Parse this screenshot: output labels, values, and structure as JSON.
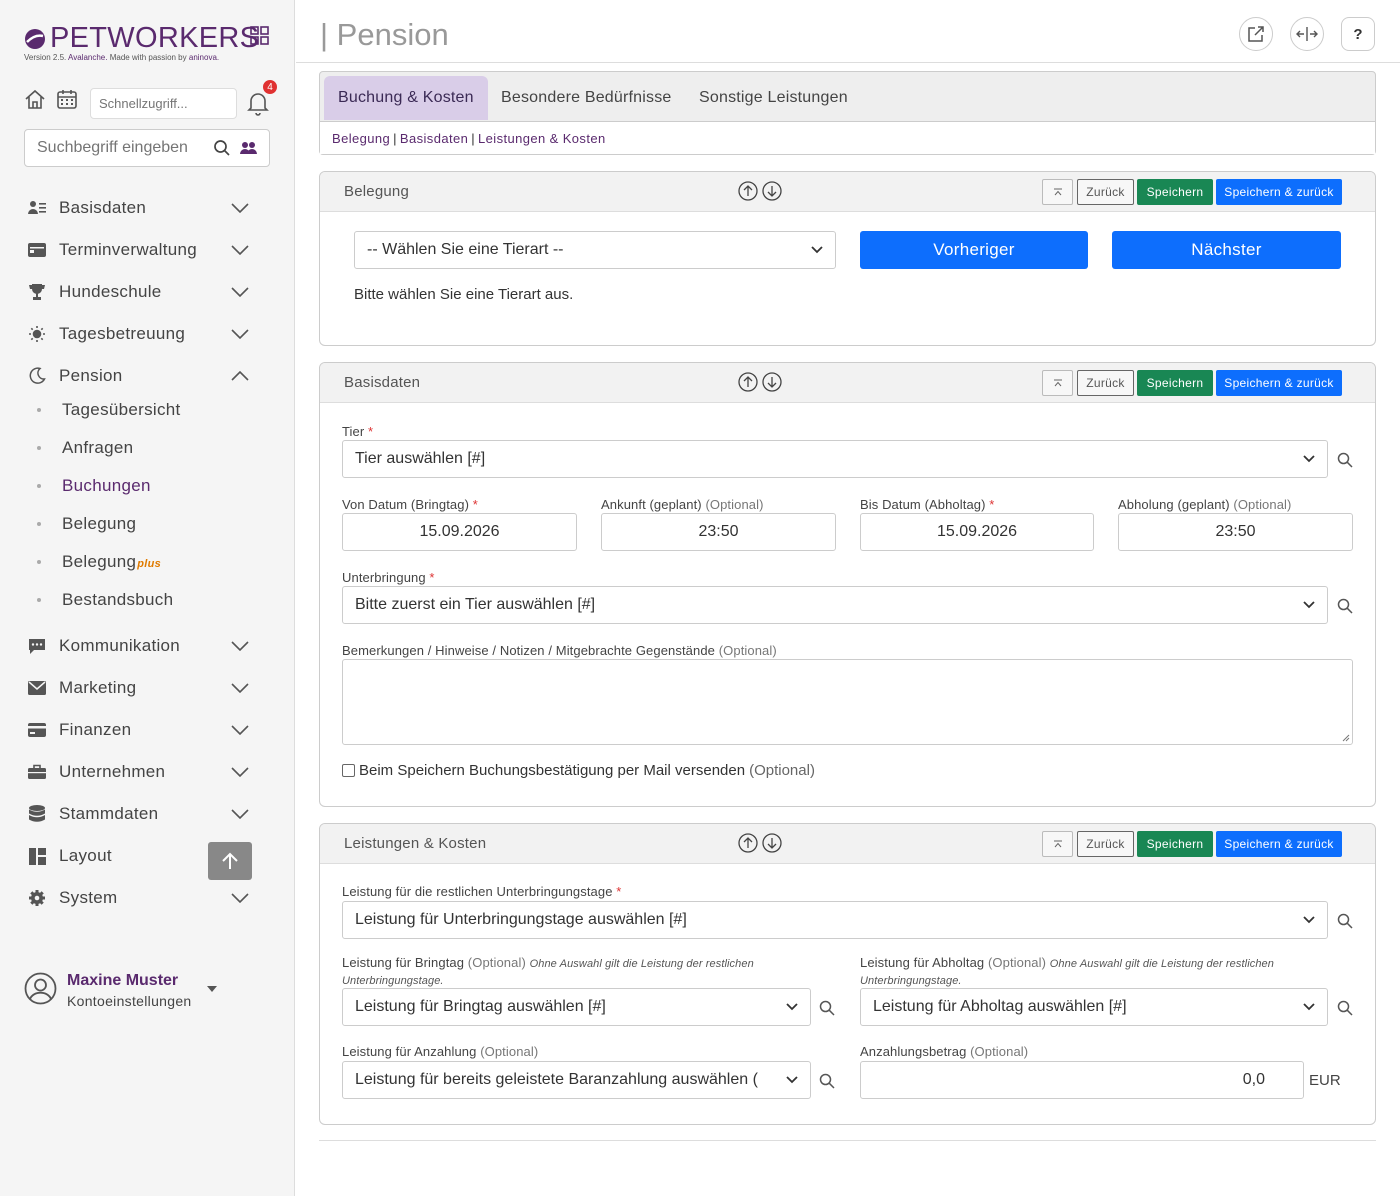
{
  "sidebar": {
    "logo": "PETWORKERS",
    "version_prefix": "Version 2.5.",
    "version_name": "Avalanche.",
    "version_mid": "Made with passion by",
    "version_company": "aninova.",
    "quick_placeholder": "Schnellzugriff...",
    "notification_count": "4",
    "search_placeholder": "Suchbegriff eingeben",
    "nav": [
      {
        "label": "Basisdaten",
        "icon": "users-list-icon"
      },
      {
        "label": "Terminverwaltung",
        "icon": "calendar-card-icon"
      },
      {
        "label": "Hundeschule",
        "icon": "trophy-icon"
      },
      {
        "label": "Tagesbetreuung",
        "icon": "sun-icon"
      },
      {
        "label": "Pension",
        "icon": "moon-icon"
      },
      {
        "label": "Kommunikation",
        "icon": "chat-icon"
      },
      {
        "label": "Marketing",
        "icon": "envelope-icon"
      },
      {
        "label": "Finanzen",
        "icon": "credit-card-icon"
      },
      {
        "label": "Unternehmen",
        "icon": "briefcase-icon"
      },
      {
        "label": "Stammdaten",
        "icon": "database-icon"
      },
      {
        "label": "Layout",
        "icon": "layout-icon"
      },
      {
        "label": "System",
        "icon": "gear-icon"
      }
    ],
    "pension_sub": [
      "Tagesübersicht",
      "Anfragen",
      "Buchungen",
      "Belegung",
      "Belegung",
      "Bestandsbuch"
    ],
    "plus_label": "plus",
    "user_name": "Maxine Muster",
    "user_sub": "Kontoeinstellungen"
  },
  "main": {
    "title": "| Pension",
    "help_label": "?",
    "tabs": [
      "Buchung & Kosten",
      "Besondere Bedürfnisse",
      "Sonstige Leistungen"
    ],
    "anchors": [
      "Belegung",
      "Basisdaten",
      "Leistungen & Kosten"
    ],
    "anchor_sep": "|",
    "btn_back": "Zurück",
    "btn_save": "Speichern",
    "btn_saveback": "Speichern & zurück",
    "belegung": {
      "title": "Belegung",
      "tierart_value": "-- Wählen Sie eine Tierart --",
      "prev": "Vorheriger",
      "next": "Nächster",
      "message": "Bitte wählen Sie eine Tierart aus."
    },
    "basisdaten": {
      "title": "Basisdaten",
      "tier_label": "Tier",
      "tier_value": "Tier auswählen [#]",
      "von_label": "Von Datum (Bringtag)",
      "von_value": "15.09.2026",
      "ankunft_label": "Ankunft (geplant)",
      "ankunft_value": "23:50",
      "bis_label": "Bis Datum (Abholtag)",
      "bis_value": "15.09.2026",
      "abholung_label": "Abholung (geplant)",
      "abholung_value": "23:50",
      "unterbringung_label": "Unterbringung",
      "unterbringung_value": "Bitte zuerst ein Tier auswählen [#]",
      "bemerkung_label": "Bemerkungen / Hinweise / Notizen / Mitgebrachte Gegenstände",
      "checkbox_label": "Beim Speichern Buchungsbestätigung per Mail versenden",
      "optional": "(Optional)",
      "required_mark": "*"
    },
    "leistungen": {
      "title": "Leistungen & Kosten",
      "rest_label": "Leistung für die restlichen Unterbringungstage",
      "rest_value": "Leistung für Unterbringungstage auswählen [#]",
      "bring_label": "Leistung für Bringtag",
      "bring_hint": "Ohne Auswahl gilt die Leistung der restlichen Unterbringungstage.",
      "bring_value": "Leistung für Bringtag auswählen [#]",
      "abhol_label": "Leistung für Abholtag",
      "abhol_hint": "Ohne Auswahl gilt die Leistung der restlichen Unterbringungstage.",
      "abhol_value": "Leistung für Abholtag auswählen [#]",
      "anz_label": "Leistung für Anzahlung",
      "anz_value": "Leistung für bereits geleistete Baranzahlung auswählen (",
      "betrag_label": "Anzahlungsbetrag",
      "betrag_value": "0,0",
      "currency": "EUR"
    }
  }
}
